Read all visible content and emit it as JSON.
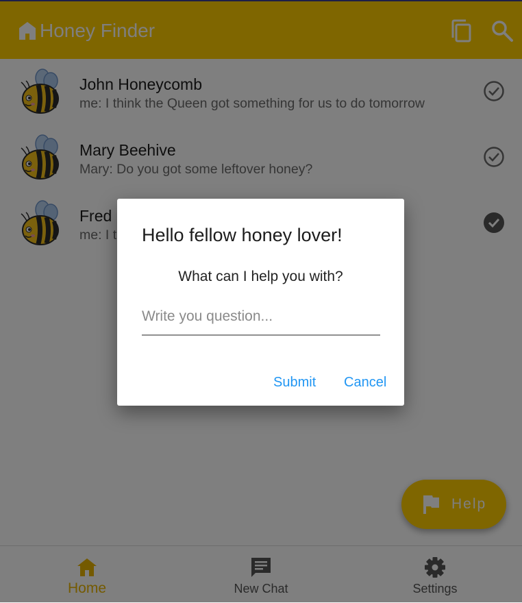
{
  "colors": {
    "primary": "#ffcc00",
    "accent_text": "#e8b400",
    "link": "#2196f3",
    "check_outline": "#6b6b6b",
    "check_filled": "#555555"
  },
  "appbar": {
    "title": "Honey Finder",
    "icons": [
      "home-icon",
      "copy-icon",
      "search-icon"
    ]
  },
  "chats": [
    {
      "name": "John Honeycomb",
      "preview": "me: I think the Queen got something for us to do tomorrow",
      "status": "read-outline"
    },
    {
      "name": "Mary Beehive",
      "preview": "Mary: Do you got some leftover honey?",
      "status": "read-outline"
    },
    {
      "name": "Fred Bumblebee",
      "preview": "me: I t",
      "status": "read-filled"
    }
  ],
  "fab": {
    "label": "Help",
    "icon": "flag-icon"
  },
  "bottom_nav": [
    {
      "label": "Home",
      "icon": "home-icon",
      "active": true
    },
    {
      "label": "New Chat",
      "icon": "chat-icon",
      "active": false
    },
    {
      "label": "Settings",
      "icon": "gear-icon",
      "active": false
    }
  ],
  "dialog": {
    "title": "Hello fellow honey lover!",
    "question": "What can I help you with?",
    "input_value": "",
    "input_placeholder": "Write you question...",
    "submit_label": "Submit",
    "cancel_label": "Cancel"
  }
}
